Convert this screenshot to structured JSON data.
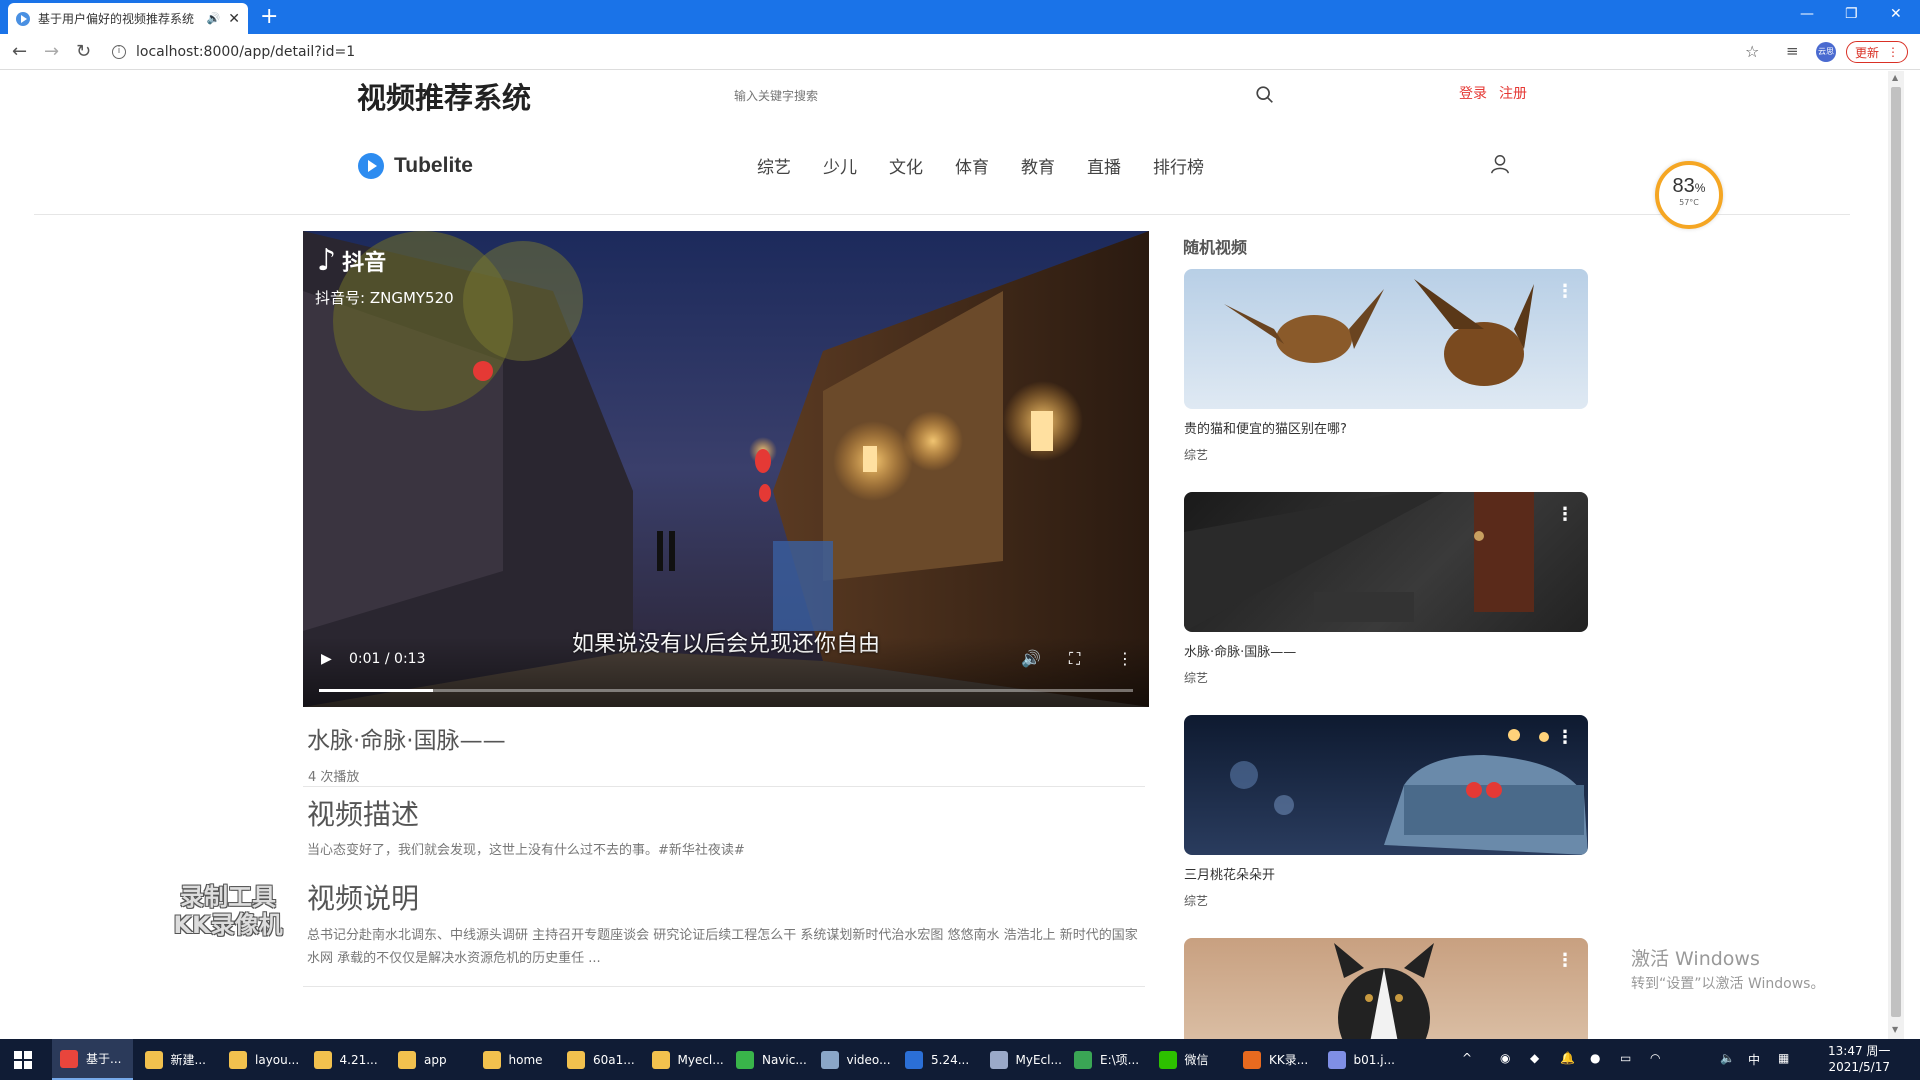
{
  "browser": {
    "tab_title": "基于用户偏好的视频推荐系统",
    "url": "localhost:8000/app/detail?id=1",
    "update_label": "更新",
    "profile_label": "云思"
  },
  "header": {
    "site_title": "视频推荐系统",
    "search_placeholder": "输入关键字搜索",
    "login": "登录",
    "register": "注册",
    "logo_text": "Tubelite",
    "nav": [
      "综艺",
      "少儿",
      "文化",
      "体育",
      "教育",
      "直播",
      "排行榜"
    ]
  },
  "gauge": {
    "percent": "83",
    "percent_unit": "%",
    "temp": "57°C"
  },
  "player": {
    "brand": "抖音",
    "douyin_id": "抖音号: ZNGMY520",
    "subtitle": "如果说没有以后会兑现还你自由",
    "time": "0:01 / 0:13",
    "progress_fraction": 0.14
  },
  "video": {
    "title": "水脉·命脉·国脉——",
    "plays": "4 次播放",
    "desc_heading": "视频描述",
    "desc_text": "当心态变好了，我们就会发现，这世上没有什么过不去的事。#新华社夜读#",
    "note_heading": "视频说明",
    "note_text": "总书记分赴南水北调东、中线源头调研 主持召开专题座谈会 研究论证后续工程怎么干 系统谋划新时代治水宏图 悠悠南水 浩浩北上 新时代的国家水网 承载的不仅仅是解决水资源危机的历史重任 ..."
  },
  "watermark": {
    "line1": "录制工具",
    "line2": "KK录像机"
  },
  "sidebar": {
    "heading": "随机视频",
    "cards": [
      {
        "title": "贵的猫和便宜的猫区别在哪?",
        "category": "综艺",
        "thumb": "owls"
      },
      {
        "title": "水脉·命脉·国脉——",
        "category": "综艺",
        "thumb": "dark"
      },
      {
        "title": "三月桃花朵朵开",
        "category": "综艺",
        "thumb": "car"
      },
      {
        "title": "",
        "category": "",
        "thumb": "dog"
      }
    ]
  },
  "activate": {
    "line1": "激活 Windows",
    "line2": "转到“设置”以激活 Windows。"
  },
  "taskbar": {
    "items": [
      {
        "label": "基于...",
        "color": "#e8453c"
      },
      {
        "label": "新建...",
        "color": "#f2c14e"
      },
      {
        "label": "layou...",
        "color": "#f2c14e"
      },
      {
        "label": "4.21...",
        "color": "#f2c14e"
      },
      {
        "label": "app",
        "color": "#f2c14e"
      },
      {
        "label": "home",
        "color": "#f2c14e"
      },
      {
        "label": "60a1...",
        "color": "#f2c14e"
      },
      {
        "label": "Myecl...",
        "color": "#f2c14e"
      },
      {
        "label": "Navic...",
        "color": "#39b54a"
      },
      {
        "label": "video...",
        "color": "#8aa6c8"
      },
      {
        "label": "5.24...",
        "color": "#2b6fd6"
      },
      {
        "label": "MyEcl...",
        "color": "#9aa9c9"
      },
      {
        "label": "E:\\项...",
        "color": "#3aa655"
      },
      {
        "label": "微信",
        "color": "#2dc100"
      },
      {
        "label": "KK录...",
        "color": "#e86a1f"
      },
      {
        "label": "b01.j...",
        "color": "#7f8fe6"
      }
    ],
    "ime": "中",
    "time": "13:47 周一",
    "date": "2021/5/17"
  }
}
